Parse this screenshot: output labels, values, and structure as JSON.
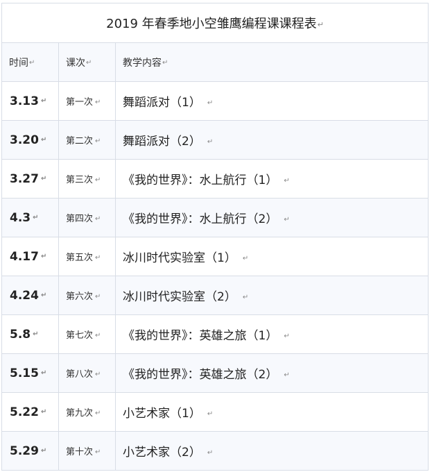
{
  "title": "2019 年春季地小空雏鹰编程课课程表",
  "headers": {
    "time": "时间",
    "session": "课次",
    "content": "教学内容"
  },
  "paragraph_mark": "↵",
  "rows": [
    {
      "date": "3.13",
      "session": "第一次",
      "content": "舞蹈派对（1）"
    },
    {
      "date": "3.20",
      "session": "第二次",
      "content": "舞蹈派对（2）"
    },
    {
      "date": "3.27",
      "session": "第三次",
      "content": "《我的世界》：水上航行（1）"
    },
    {
      "date": "4.3",
      "session": "第四次",
      "content": "《我的世界》：水上航行（2）"
    },
    {
      "date": "4.17",
      "session": "第五次",
      "content": "冰川时代实验室（1）"
    },
    {
      "date": "4.24",
      "session": "第六次",
      "content": "冰川时代实验室（2）"
    },
    {
      "date": "5.8",
      "session": "第七次",
      "content": "《我的世界》：英雄之旅（1）"
    },
    {
      "date": "5.15",
      "session": "第八次",
      "content": "《我的世界》：英雄之旅（2）"
    },
    {
      "date": "5.22",
      "session": "第九次",
      "content": "小艺术家（1）"
    },
    {
      "date": "5.29",
      "session": "第十次",
      "content": "小艺术家（2）"
    }
  ]
}
